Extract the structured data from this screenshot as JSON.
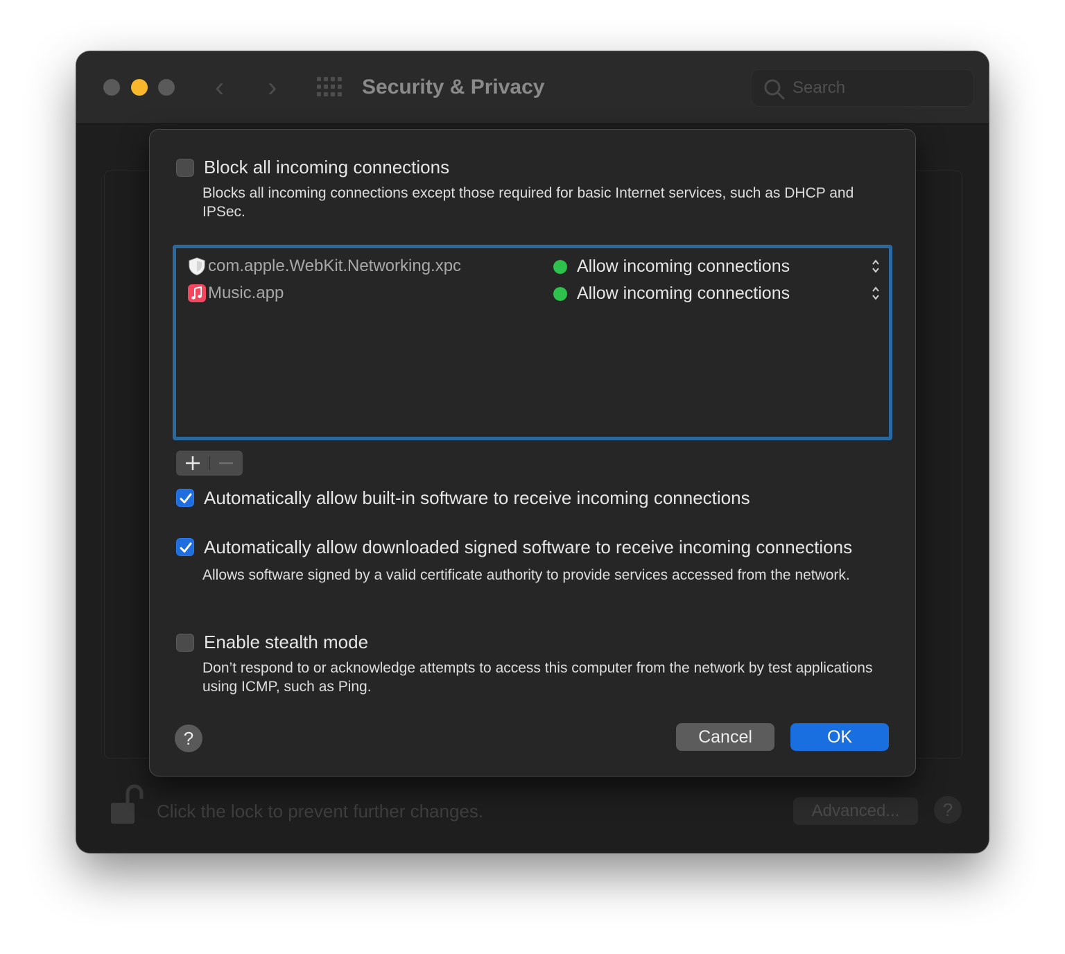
{
  "window": {
    "title": "Security & Privacy",
    "search_placeholder": "Search"
  },
  "background": {
    "lock_text": "Click the lock to prevent further changes.",
    "advanced_label": "Advanced...",
    "help_label": "?"
  },
  "sheet": {
    "block_all": {
      "label": "Block all incoming connections",
      "description": "Blocks all incoming connections except those required for basic Internet services, such as DHCP and IPSec.",
      "checked": false
    },
    "apps": [
      {
        "name": "com.apple.WebKit.Networking.xpc",
        "icon": "shield-icon",
        "status": "Allow incoming connections",
        "status_color": "#2ec14c"
      },
      {
        "name": "Music.app",
        "icon": "music-app-icon",
        "status": "Allow incoming connections",
        "status_color": "#2ec14c"
      }
    ],
    "auto_builtin": {
      "label": "Automatically allow built-in software to receive incoming connections",
      "checked": true
    },
    "auto_signed": {
      "label": "Automatically allow downloaded signed software to receive incoming connections",
      "description": "Allows software signed by a valid certificate authority to provide services accessed from the network.",
      "checked": true
    },
    "stealth": {
      "label": "Enable stealth mode",
      "description": "Don’t respond to or acknowledge attempts to access this computer from the network by test applications using ICMP, such as Ping.",
      "checked": false
    },
    "help_label": "?",
    "cancel_label": "Cancel",
    "ok_label": "OK"
  },
  "colors": {
    "accent": "#1a6fe0",
    "list_focus": "#2b6aa0",
    "minimize": "#f9b82b"
  }
}
